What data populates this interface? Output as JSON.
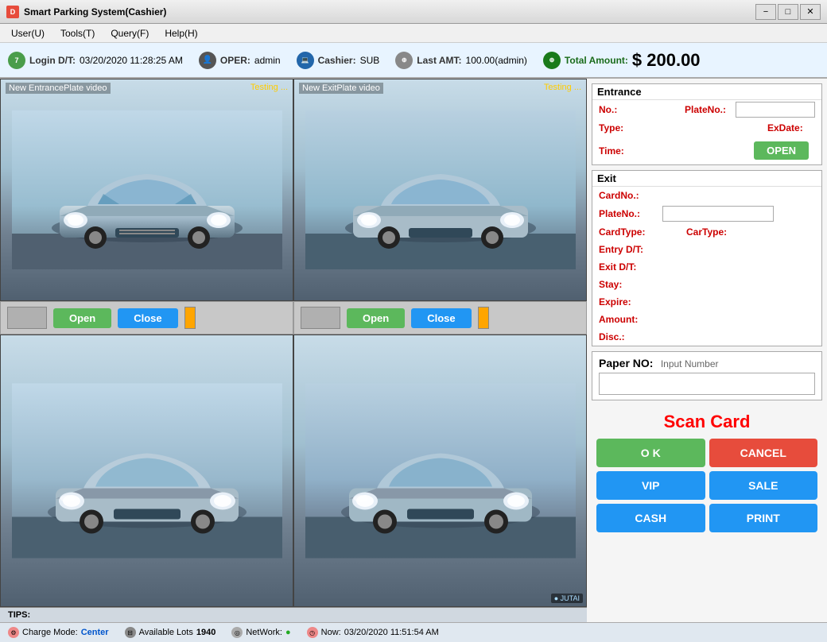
{
  "titleBar": {
    "title": "Smart Parking System(Cashier)",
    "iconText": "D",
    "minBtn": "−",
    "maxBtn": "□",
    "closeBtn": "✕"
  },
  "menuBar": {
    "items": [
      "User(U)",
      "Tools(T)",
      "Query(F)",
      "Help(H)"
    ]
  },
  "statusTop": {
    "loginLabel": "Login D/T:",
    "loginValue": "03/20/2020 11:28:25 AM",
    "operLabel": "OPER:",
    "operValue": "admin",
    "cashierLabel": "Cashier:",
    "cashierValue": "SUB",
    "lastAmtLabel": "Last AMT:",
    "lastAmtValue": "100.00(admin)",
    "totalLabel": "Total Amount:",
    "totalValue": "$ 200.00"
  },
  "cameras": {
    "top": [
      {
        "label": "New EntrancePlate video",
        "status": "Testing ..."
      },
      {
        "label": "New ExitPlate video",
        "status": "Testing ..."
      }
    ],
    "controls": [
      {
        "openBtn": "Open",
        "closeBtn": "Close"
      },
      {
        "openBtn": "Open",
        "closeBtn": "Close"
      }
    ]
  },
  "entranceSection": {
    "title": "Entrance",
    "noLabel": "No.:",
    "plateNoLabel": "PlateNo.:",
    "typeLabel": "Type:",
    "exDateLabel": "ExDate:",
    "timeLabel": "Time:",
    "openBtn": "OPEN"
  },
  "exitSection": {
    "title": "Exit",
    "cardNoLabel": "CardNo.:",
    "plateNoLabel": "PlateNo.:",
    "cardTypeLabel": "CardType:",
    "carTypeLabel": "CarType:",
    "entryDTLabel": "Entry D/T:",
    "exitDTLabel": "Exit D/T:",
    "stayLabel": "Stay:",
    "expireLabel": "Expire:",
    "amountLabel": "Amount:",
    "discLabel": "Disc.:"
  },
  "paperNo": {
    "label": "Paper NO:",
    "hint": "Input Number"
  },
  "scanCard": {
    "text": "Scan Card"
  },
  "buttons": {
    "ok": "O K",
    "cancel": "CANCEL",
    "vip": "VIP",
    "sale": "SALE",
    "cash": "CASH",
    "print": "PRINT"
  },
  "statusBottom": {
    "tips": "TIPS:",
    "chargeModeLabel": "Charge Mode:",
    "chargeModeValue": "Center",
    "availableLabel": "Available Lots",
    "availableValue": "1940",
    "networkLabel": "NetWork:",
    "networkStatus": "●",
    "nowLabel": "Now:",
    "nowValue": "03/20/2020 11:51:54 AM",
    "watermark": "● JUTAI"
  }
}
